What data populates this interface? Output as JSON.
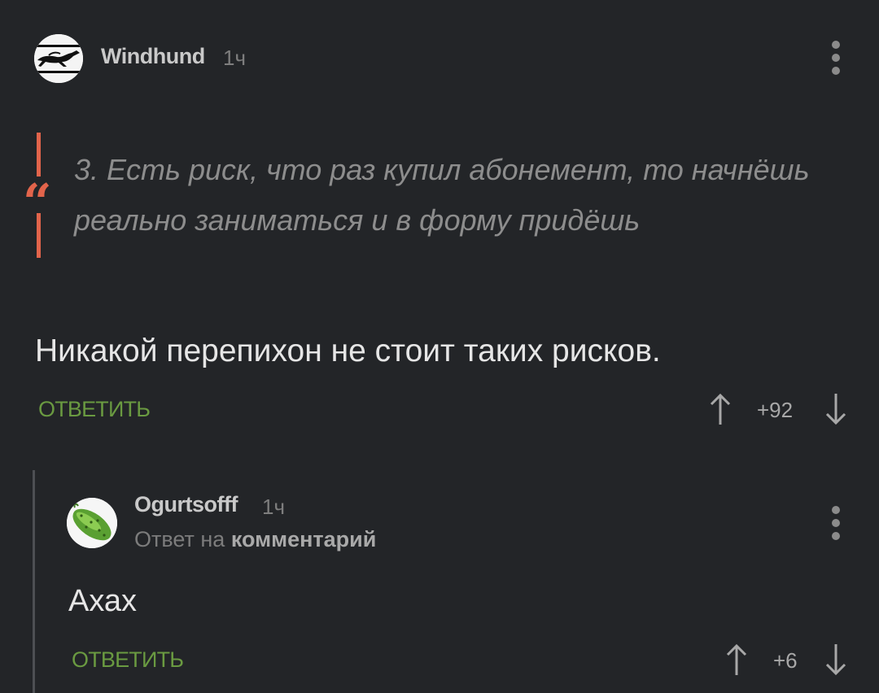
{
  "comments": [
    {
      "author": "Windhund",
      "time": "1ч",
      "quote": "3. Есть риск, что раз купил абонемент, то начнёшь реально заниматься и в форму придёшь",
      "text": "Никакой перепихон не стоит таких рисков.",
      "reply_label": "ОТВЕТИТЬ",
      "votes": "+92",
      "avatar_icon": "greyhound-icon",
      "more_icon": "more-vertical-icon"
    },
    {
      "author": "Ogurtsofff",
      "time": "1ч",
      "reply_to_prefix": "Ответ на",
      "reply_to_target": "комментарий",
      "text": "Ахах",
      "reply_label": "ОТВЕТИТЬ",
      "votes": "+6",
      "avatar_icon": "cucumber-icon",
      "more_icon": "more-vertical-icon"
    }
  ],
  "colors": {
    "background": "#232528",
    "accent_quote": "#e2644b",
    "reply_button": "#6a9a41",
    "thread_line": "#4d4f53"
  }
}
